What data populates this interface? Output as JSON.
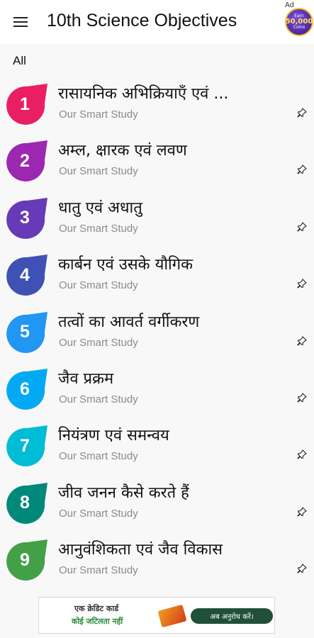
{
  "appbar": {
    "title": "10th Science Objectives",
    "ad": {
      "label": "Ad",
      "coin_top": "Earn",
      "coin_amount": "50,000",
      "coin_bottom": "Coins"
    }
  },
  "filter_label": "All",
  "chapters": [
    {
      "number": "1",
      "title": "रासायनिक अभिक्रियाएँ एवं ...",
      "subtitle": "Our Smart Study",
      "color": "#e91e63"
    },
    {
      "number": "2",
      "title": "अम्ल, क्षारक एवं लवण",
      "subtitle": "Our Smart Study",
      "color": "#9c27b0"
    },
    {
      "number": "3",
      "title": "धातु एवं अधातु",
      "subtitle": "Our Smart Study",
      "color": "#673ab7"
    },
    {
      "number": "4",
      "title": "कार्बन एवं उसके यौगिक",
      "subtitle": "Our Smart Study",
      "color": "#3f51b5"
    },
    {
      "number": "5",
      "title": "तत्वों का आवर्त वर्गीकरण",
      "subtitle": "Our Smart Study",
      "color": "#2196f3"
    },
    {
      "number": "6",
      "title": "जैव प्रक्रम",
      "subtitle": "Our Smart Study",
      "color": "#03a9f4"
    },
    {
      "number": "7",
      "title": "नियंत्रण एवं समन्वय",
      "subtitle": "Our Smart Study",
      "color": "#00bcd4"
    },
    {
      "number": "8",
      "title": "जीव जनन कैसे करते हैं",
      "subtitle": "Our Smart Study",
      "color": "#00897b"
    },
    {
      "number": "9",
      "title": "आनुवंशिकता एवं जैव विकास",
      "subtitle": "Our Smart Study",
      "color": "#43a047"
    }
  ],
  "banner": {
    "line1": "एक क्रेडिट कार्ड",
    "line2": "कोई जटिलता नहीं",
    "cta": "अब अनुरोध करें।"
  }
}
